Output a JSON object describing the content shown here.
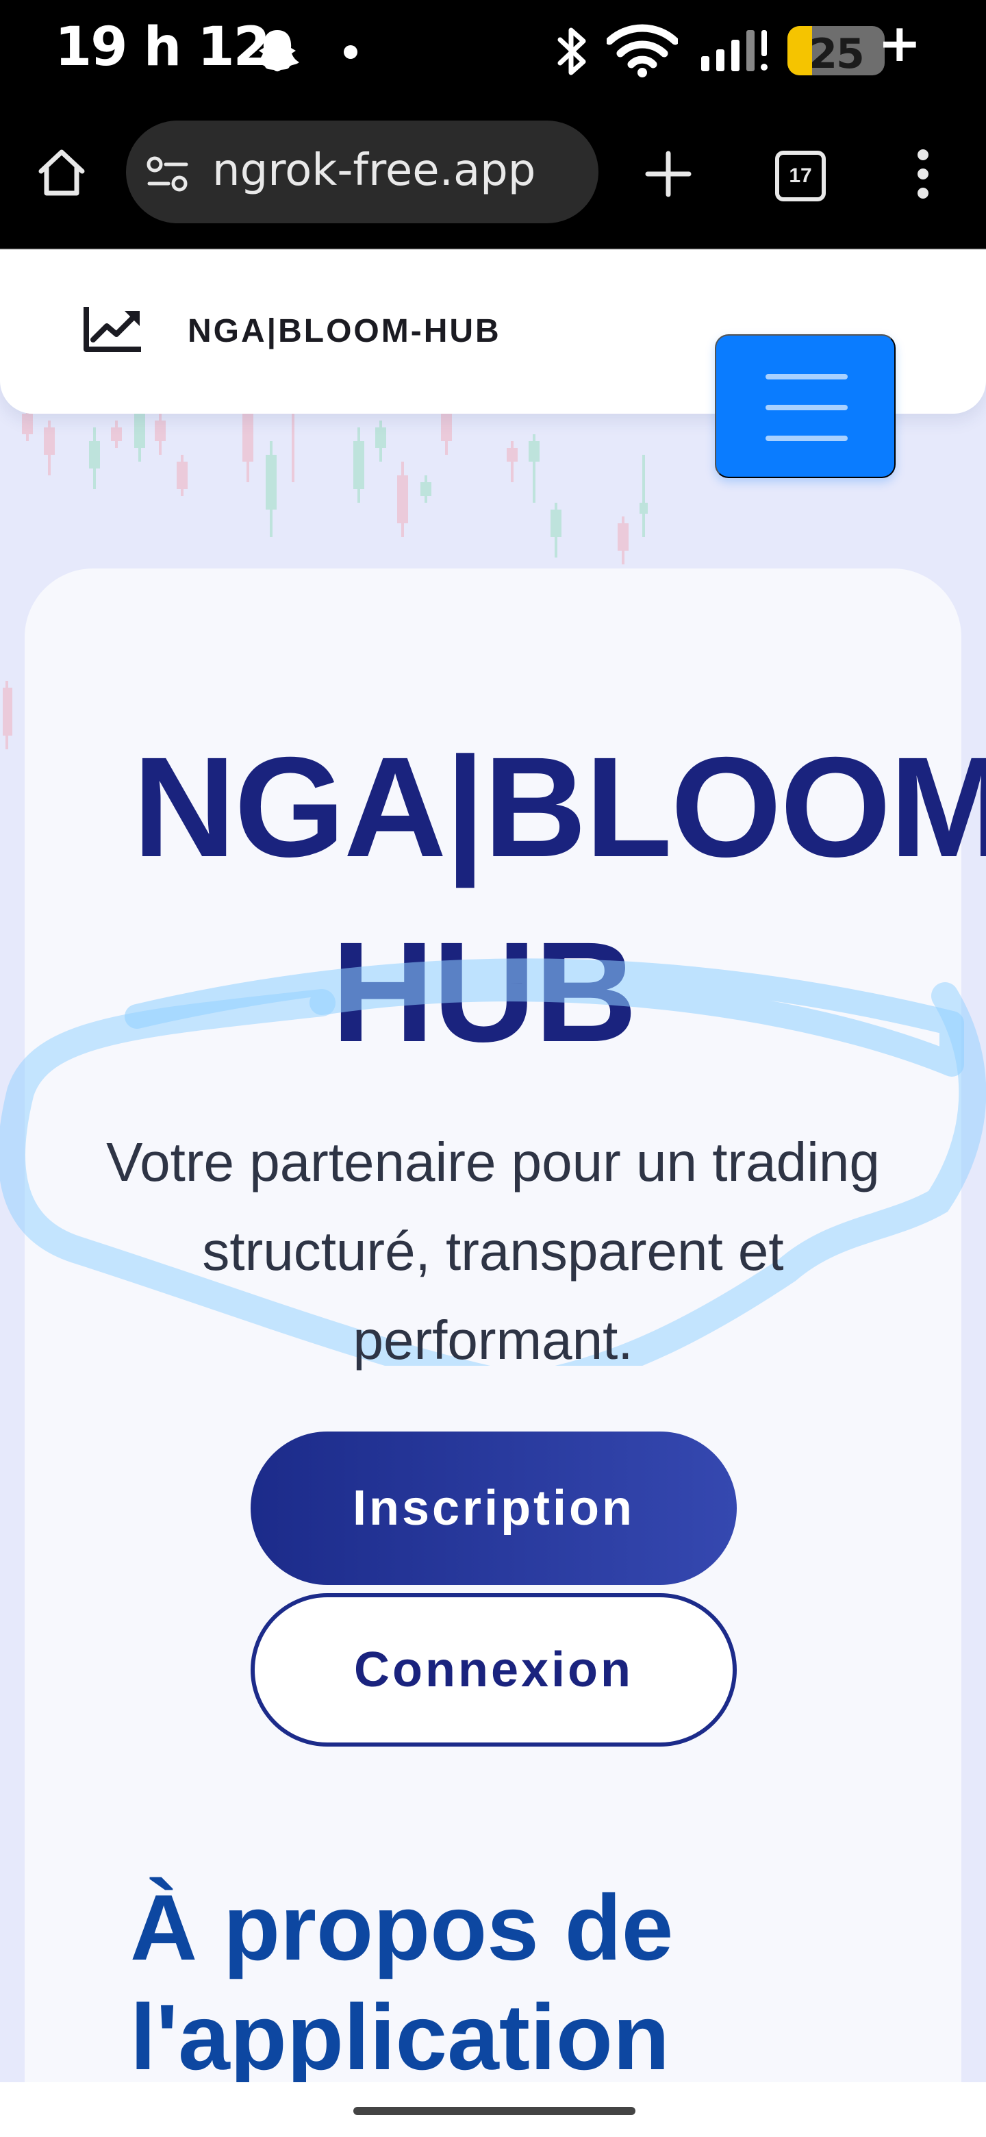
{
  "status_bar": {
    "time": "19 h 12",
    "battery_level": "25",
    "battery_fraction": 0.25,
    "charging_symbol": "+",
    "icons": [
      "snapchat-ghost-icon",
      "notification-dot-icon",
      "bluetooth-icon",
      "wifi-icon",
      "signal-icon",
      "battery-icon"
    ]
  },
  "browser": {
    "url": "ngrok-free.app",
    "tab_count": "17",
    "icons": [
      "home-icon",
      "site-settings-icon",
      "new-tab-icon",
      "tab-switcher-icon",
      "more-menu-icon"
    ]
  },
  "navbar": {
    "brand": "NGA|BLOOM-HUB",
    "brand_icon": "trending-chart-icon",
    "menu_icon": "hamburger-menu-icon"
  },
  "hero": {
    "title_line1": "NGA|BLOOM-",
    "title_line2": "HUB",
    "tagline": "Votre partenaire pour un trading structuré, transparent et performant.",
    "signup_label": "Inscription",
    "login_label": "Connexion"
  },
  "about": {
    "title": "À propos de l'application"
  },
  "colors": {
    "primary_navy": "#1a237e",
    "accent_blue": "#0a7cff",
    "about_title_blue": "#0d47a1",
    "page_background": "#e6e9fb",
    "scribble": "#8fd0ff"
  }
}
